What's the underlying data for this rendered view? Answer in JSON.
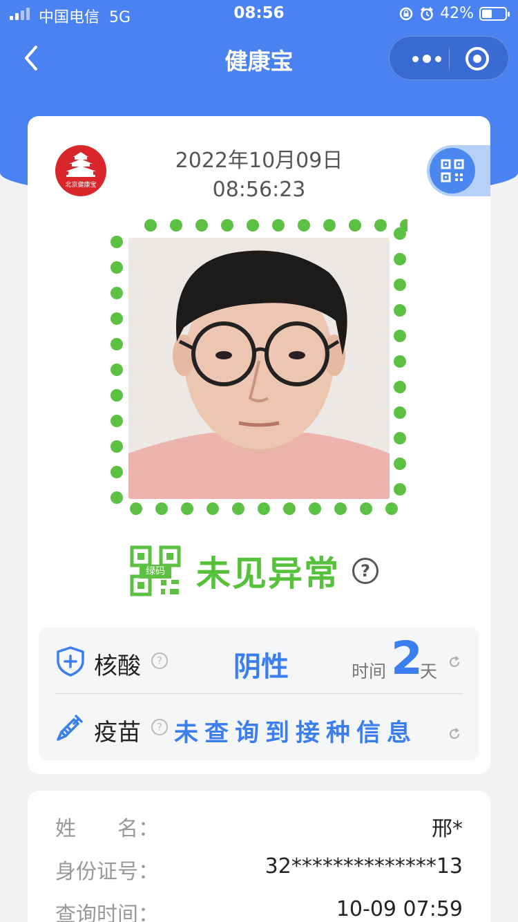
{
  "status_bar": {
    "carrier": "中国电信",
    "network": "5G",
    "time": "08:56",
    "battery": "42%"
  },
  "nav": {
    "title": "健康宝"
  },
  "card": {
    "logo_text": "北京健康宝",
    "date": "2022年10月09日",
    "time": "08:56:23",
    "status_badge": "绿码",
    "status_text": "未见异常",
    "status_help": "?"
  },
  "tests": {
    "nucleic": {
      "label": "核酸",
      "help": "?",
      "result": "阴性",
      "time_label": "时间",
      "days": "2",
      "days_unit": "天"
    },
    "vaccine": {
      "label": "疫苗",
      "help": "?",
      "result": "未查询到接种信息"
    }
  },
  "info": {
    "name_label": "姓　　名：",
    "name_value": "邢*",
    "id_label": "身份证号：",
    "id_value": "32**************13",
    "query_label": "查询时间：",
    "query_value": "10-09 07:59"
  },
  "colors": {
    "header_blue": "#4a82f2",
    "status_green": "#56c13b",
    "accent_blue": "#3b7ef0",
    "logo_red": "#d8262a"
  }
}
